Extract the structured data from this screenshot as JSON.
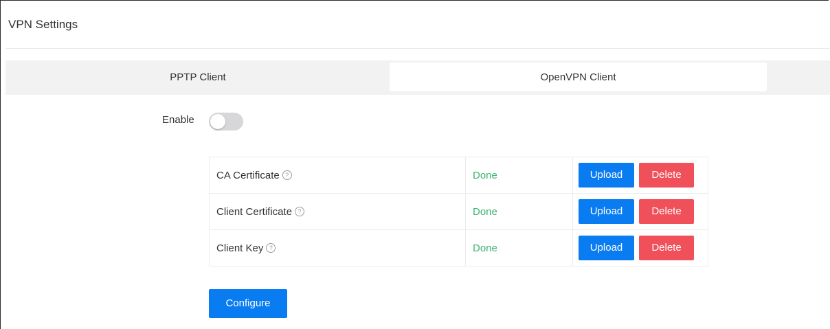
{
  "page": {
    "title": "VPN Settings"
  },
  "tabs": [
    {
      "label": "PPTP Client",
      "active": false
    },
    {
      "label": "OpenVPN Client",
      "active": true
    }
  ],
  "enable": {
    "label": "Enable",
    "on": false
  },
  "certificates": [
    {
      "name": "CA Certificate",
      "status": "Done",
      "upload_label": "Upload",
      "delete_label": "Delete"
    },
    {
      "name": "Client Certificate",
      "status": "Done",
      "upload_label": "Upload",
      "delete_label": "Delete"
    },
    {
      "name": "Client Key",
      "status": "Done",
      "upload_label": "Upload",
      "delete_label": "Delete"
    }
  ],
  "help_glyph": "?",
  "configure_label": "Configure",
  "colors": {
    "primary": "#0a7cf2",
    "danger": "#f0505a",
    "success": "#3cb371",
    "tabbar_bg": "#f2f2f3"
  },
  "icons": {
    "help": "help-circle-icon"
  }
}
